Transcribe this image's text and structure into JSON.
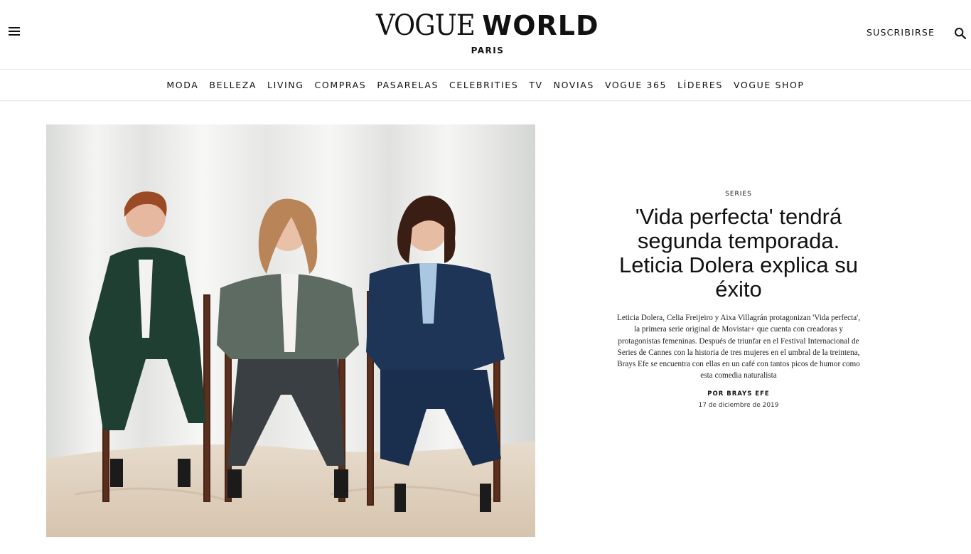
{
  "header": {
    "logo_vogue": "VOGUE",
    "logo_world": "WORLD",
    "logo_city": "PARIS",
    "subscribe_label": "SUSCRIBIRSE",
    "icons": {
      "menu": "hamburger-menu-icon",
      "search": "search-icon"
    }
  },
  "nav": {
    "items": [
      {
        "label": "MODA"
      },
      {
        "label": "BELLEZA"
      },
      {
        "label": "LIVING"
      },
      {
        "label": "COMPRAS"
      },
      {
        "label": "PASARELAS"
      },
      {
        "label": "CELEBRITIES"
      },
      {
        "label": "TV"
      },
      {
        "label": "NOVIAS"
      },
      {
        "label": "VOGUE 365"
      },
      {
        "label": "LÍDERES"
      },
      {
        "label": "VOGUE SHOP"
      }
    ]
  },
  "article": {
    "section": "SERIES",
    "headline": "'Vida perfecta' tendrá segunda temporada. Leticia Dolera explica su éxito",
    "dek": "Leticia Dolera, Celia Freijeiro y Aixa Villagrán protagonizan 'Vida perfecta', la primera serie original de Movistar+ que cuenta con creadoras y protagonistas femeninas. Después de triunfar en el Festival Internacional de Series de Cannes con la historia de tres mujeres en el umbral de la treintena, Brays Efe se encuentra con ellas en un café con tantos picos de humor como esta comedia naturalista",
    "byline_prefix": "POR ",
    "author": "BRAYS EFE",
    "date": "17 de diciembre de 2019"
  },
  "colors": {
    "text": "#111111",
    "border": "#e6e6e6",
    "backdrop": "#efeeec",
    "suit_green": "#1f3f33",
    "suit_grey": "#5e6b63",
    "suit_navy": "#1e3557"
  }
}
